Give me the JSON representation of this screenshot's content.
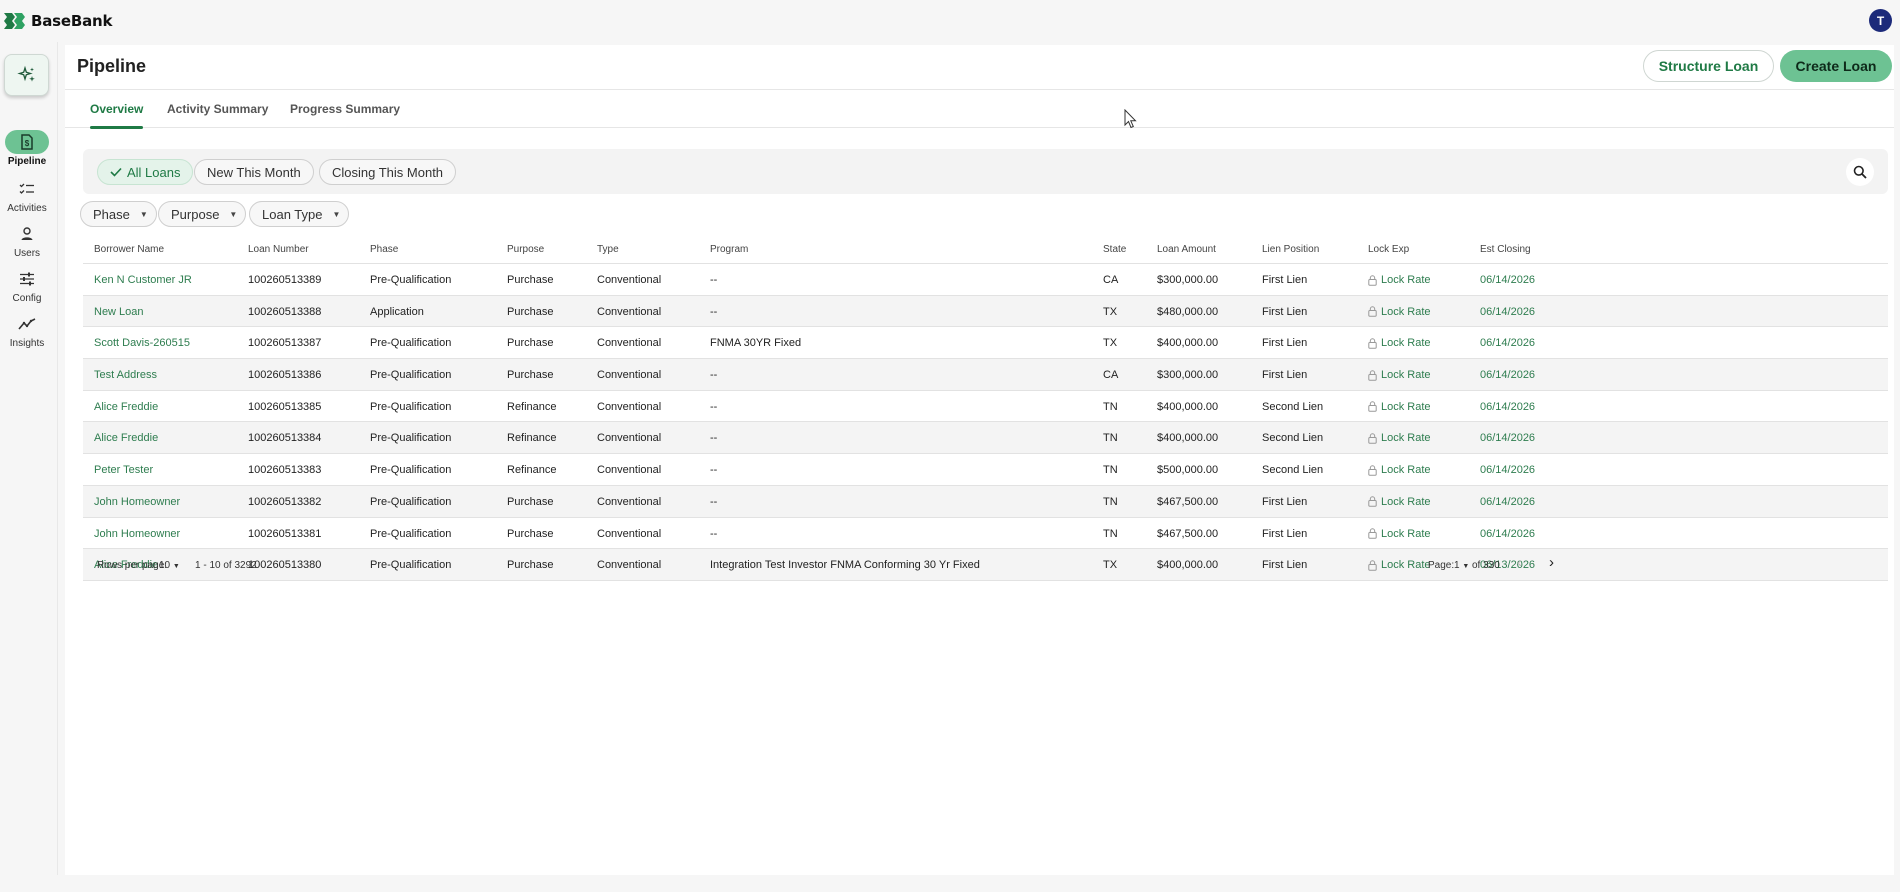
{
  "app": {
    "brand_name": "BaseBank",
    "user_initial": "T",
    "accent_color": "#1f7a45",
    "button_green": "#6dc293"
  },
  "rail": {
    "items": [
      {
        "label": "Pipeline",
        "icon": "document-dollar-icon",
        "active": true
      },
      {
        "label": "Activities",
        "icon": "checklist-icon",
        "active": false
      },
      {
        "label": "Users",
        "icon": "user-icon",
        "active": false
      },
      {
        "label": "Config",
        "icon": "sliders-icon",
        "active": false
      },
      {
        "label": "Insights",
        "icon": "trend-icon",
        "active": false
      }
    ]
  },
  "header": {
    "title": "Pipeline",
    "structure_loan_label": "Structure Loan",
    "create_loan_label": "Create Loan"
  },
  "tabs": [
    {
      "label": "Overview",
      "active": true
    },
    {
      "label": "Activity Summary",
      "active": false
    },
    {
      "label": "Progress Summary",
      "active": false
    }
  ],
  "quick_filters": [
    {
      "label": "All Loans",
      "selected": true
    },
    {
      "label": "New This Month",
      "selected": false
    },
    {
      "label": "Closing This Month",
      "selected": false
    }
  ],
  "dropdown_filters": [
    {
      "label": "Phase"
    },
    {
      "label": "Purpose"
    },
    {
      "label": "Loan Type"
    }
  ],
  "table": {
    "columns": [
      "Borrower Name",
      "Loan Number",
      "Phase",
      "Purpose",
      "Type",
      "Program",
      "State",
      "Loan Amount",
      "Lien Position",
      "Lock Exp",
      "Est Closing"
    ],
    "rows": [
      {
        "borrower": "Ken N Customer JR",
        "loan_number": "100260513389",
        "phase": "Pre-Qualification",
        "purpose": "Purchase",
        "type": "Conventional",
        "program": "--",
        "state": "CA",
        "amount": "$300,000.00",
        "lien": "First Lien",
        "lock": "Lock Rate",
        "est_closing": "06/14/2026"
      },
      {
        "borrower": "New Loan",
        "loan_number": "100260513388",
        "phase": "Application",
        "purpose": "Purchase",
        "type": "Conventional",
        "program": "--",
        "state": "TX",
        "amount": "$480,000.00",
        "lien": "First Lien",
        "lock": "Lock Rate",
        "est_closing": "06/14/2026"
      },
      {
        "borrower": "Scott Davis-260515",
        "loan_number": "100260513387",
        "phase": "Pre-Qualification",
        "purpose": "Purchase",
        "type": "Conventional",
        "program": "FNMA 30YR Fixed",
        "state": "TX",
        "amount": "$400,000.00",
        "lien": "First Lien",
        "lock": "Lock Rate",
        "est_closing": "06/14/2026"
      },
      {
        "borrower": "Test Address",
        "loan_number": "100260513386",
        "phase": "Pre-Qualification",
        "purpose": "Purchase",
        "type": "Conventional",
        "program": "--",
        "state": "CA",
        "amount": "$300,000.00",
        "lien": "First Lien",
        "lock": "Lock Rate",
        "est_closing": "06/14/2026"
      },
      {
        "borrower": "Alice Freddie",
        "loan_number": "100260513385",
        "phase": "Pre-Qualification",
        "purpose": "Refinance",
        "type": "Conventional",
        "program": "--",
        "state": "TN",
        "amount": "$400,000.00",
        "lien": "Second Lien",
        "lock": "Lock Rate",
        "est_closing": "06/14/2026"
      },
      {
        "borrower": "Alice Freddie",
        "loan_number": "100260513384",
        "phase": "Pre-Qualification",
        "purpose": "Refinance",
        "type": "Conventional",
        "program": "--",
        "state": "TN",
        "amount": "$400,000.00",
        "lien": "Second Lien",
        "lock": "Lock Rate",
        "est_closing": "06/14/2026"
      },
      {
        "borrower": "Peter Tester",
        "loan_number": "100260513383",
        "phase": "Pre-Qualification",
        "purpose": "Refinance",
        "type": "Conventional",
        "program": "--",
        "state": "TN",
        "amount": "$500,000.00",
        "lien": "Second Lien",
        "lock": "Lock Rate",
        "est_closing": "06/14/2026"
      },
      {
        "borrower": "John Homeowner",
        "loan_number": "100260513382",
        "phase": "Pre-Qualification",
        "purpose": "Purchase",
        "type": "Conventional",
        "program": "--",
        "state": "TN",
        "amount": "$467,500.00",
        "lien": "First Lien",
        "lock": "Lock Rate",
        "est_closing": "06/14/2026"
      },
      {
        "borrower": "John Homeowner",
        "loan_number": "100260513381",
        "phase": "Pre-Qualification",
        "purpose": "Purchase",
        "type": "Conventional",
        "program": "--",
        "state": "TN",
        "amount": "$467,500.00",
        "lien": "First Lien",
        "lock": "Lock Rate",
        "est_closing": "06/14/2026"
      },
      {
        "borrower": "Alice Freddie",
        "loan_number": "100260513380",
        "phase": "Pre-Qualification",
        "purpose": "Purchase",
        "type": "Conventional",
        "program": "Integration Test Investor FNMA Conforming 30 Yr Fixed",
        "state": "TX",
        "amount": "$400,000.00",
        "lien": "First Lien",
        "lock": "Lock Rate",
        "est_closing": "06/13/2026"
      }
    ]
  },
  "pagination": {
    "rows_per_page_label": "Rows per page:",
    "rows_per_page_value": "10",
    "range_text": "1 - 10 of 3292",
    "page_label": "Page:",
    "page_value": "1",
    "of_pages_text": "of 330"
  }
}
